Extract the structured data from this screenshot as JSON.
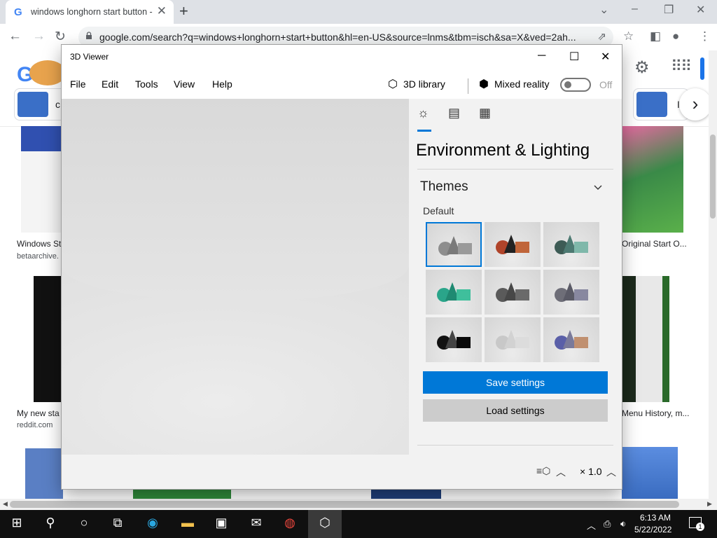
{
  "browser": {
    "tab_title": "windows longhorn start button -",
    "tab_favicon": "G",
    "url": "google.com/search?q=windows+longhorn+start+button&hl=en-US&source=lnms&tbm=isch&sa=X&ved=2ah...",
    "icons": [
      "back-icon",
      "forward-icon",
      "reload-icon",
      "lock-icon",
      "share-icon",
      "star-icon",
      "sidepanel-icon",
      "profile-icon",
      "menu-icon",
      "close-icon",
      "minimize-icon",
      "restore-icon"
    ]
  },
  "google": {
    "chip_letter": "c",
    "chip_letter_right": "I",
    "results": [
      {
        "caption": "Windows St",
        "source": "betaarchive."
      },
      {
        "caption": "Original Start O...",
        "source": ""
      },
      {
        "caption": "My new sta",
        "source": "reddit.com"
      },
      {
        "caption": "Menu History, m...",
        "source": ""
      }
    ]
  },
  "viewer": {
    "title": "3D Viewer",
    "menu": [
      "File",
      "Edit",
      "Tools",
      "View",
      "Help"
    ],
    "library_label": "3D library",
    "mixed_reality_label": "Mixed reality",
    "toggle_state": "Off",
    "panel": {
      "heading": "Environment & Lighting",
      "section": "Themes",
      "theme_name": "Default",
      "save_label": "Save settings",
      "load_label": "Load settings",
      "accent": "#0078d7"
    },
    "zoom_label": "× 1.0"
  },
  "taskbar": {
    "time": "6:13 AM",
    "date": "5/22/2022",
    "notification_count": "1"
  }
}
